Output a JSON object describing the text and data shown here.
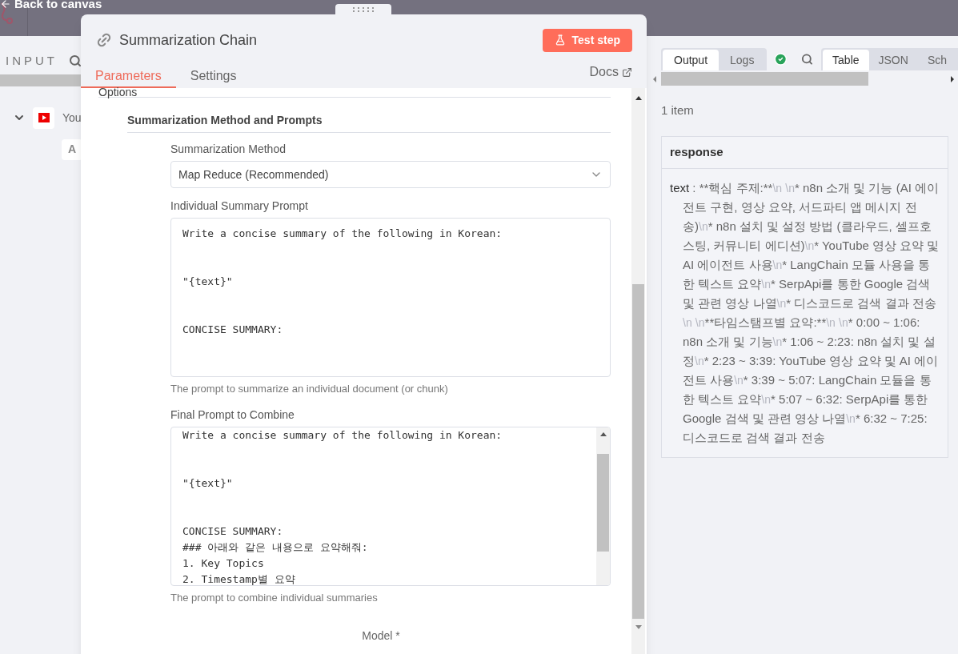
{
  "top_bar": {
    "back_label": "Back to canvas"
  },
  "input_panel": {
    "title": "INPUT",
    "nodes": [
      {
        "label": "You",
        "expanded": true
      }
    ],
    "field_icon": "A"
  },
  "node_dialog": {
    "title": "Summarization Chain",
    "test_button": "Test step",
    "tabs": [
      {
        "label": "Parameters",
        "selected": true
      },
      {
        "label": "Settings",
        "selected": false
      }
    ],
    "docs_link": "Docs",
    "section": "Options",
    "group_title": "Summarization Method and Prompts",
    "fields": [
      {
        "kind": "select",
        "label": "Summarization Method",
        "value": "Map Reduce (Recommended)"
      },
      {
        "kind": "textarea",
        "label": "Individual Summary Prompt",
        "blocks": [
          [
            "Write a concise summary of the following in Korean:"
          ],
          [
            "\"{text}\""
          ],
          [
            "CONCISE SUMMARY:"
          ]
        ],
        "hint": "The prompt to summarize an individual document (or chunk)",
        "scrolled": false
      },
      {
        "kind": "textarea",
        "label": "Final Prompt to Combine",
        "blocks": [
          [
            "Write a concise summary of the following in Korean:"
          ],
          [
            "\"{text}\""
          ],
          [
            "CONCISE SUMMARY:",
            "### 아래와 같은 내용으로 요약해줘:",
            "1. Key Topics",
            "2. Timestamp별 요약"
          ]
        ],
        "hint": "The prompt to combine individual summaries",
        "scrolled": true
      }
    ],
    "next_field_label": "Model *"
  },
  "output_panel": {
    "tabs": [
      {
        "label": "Output",
        "selected": true
      },
      {
        "label": "Logs",
        "selected": false
      }
    ],
    "views": [
      {
        "label": "Table",
        "selected": true
      },
      {
        "label": "JSON",
        "selected": false
      },
      {
        "label": "Sch",
        "selected": false
      }
    ],
    "item_count": "1 item",
    "column": "response",
    "key": "text",
    "separator": ":",
    "value": "**핵심 주제:**\\n \\n* n8n 소개 및 기능 (AI 에이전트 구현, 영상 요약, 서드파티 앱 메시지 전송)\\n* n8n 설치 및 설정 방법 (클라우드, 셀프호스팅, 커뮤니티 에디션)\\n* YouTube 영상 요약 및 AI 에이전트 사용\\n* LangChain 모듈 사용을 통한 텍스트 요약\\n* SerpApi를 통한 Google 검색 및 관련 영상 나열\\n* 디스코드로 검색 결과 전송\\n \\n**타임스탬프별 요약:**\\n \\n* 0:00 ~ 1:06: n8n 소개 및 기능\\n* 1:06 ~ 2:23: n8n 설치 및 설정\\n* 2:23 ~ 3:39: YouTube 영상 요약 및 AI 에이전트 사용\\n* 3:39 ~ 5:07: LangChain 모듈을 통한 텍스트 요약\\n* 5:07 ~ 6:32: SerpApi를 통한 Google 검색 및 관련 영상 나열\\n* 6:32 ~ 7:25: 디스코드로 검색 결과 전송"
  }
}
